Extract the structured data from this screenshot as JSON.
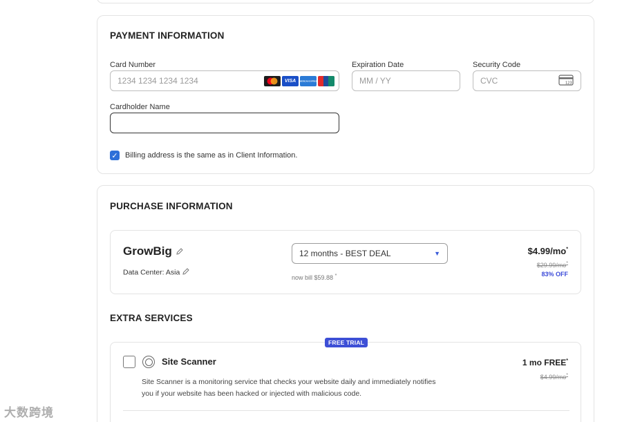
{
  "payment": {
    "title": "PAYMENT INFORMATION",
    "card_number": {
      "label": "Card Number",
      "placeholder": "1234 1234 1234 1234"
    },
    "expiration": {
      "label": "Expiration Date",
      "placeholder": "MM / YY"
    },
    "security": {
      "label": "Security Code",
      "placeholder": "CVC"
    },
    "cardholder": {
      "label": "Cardholder Name",
      "value": ""
    },
    "card_brands": [
      "mastercard-icon",
      "visa-icon",
      "amex-icon",
      "unionpay-icon"
    ],
    "brand_labels": {
      "visa": "VISA",
      "amex": "AMERICAN EXPRESS"
    },
    "billing_same": {
      "checked": true,
      "label": "Billing address is the same as in Client Information."
    }
  },
  "purchase": {
    "title": "PURCHASE INFORMATION",
    "plan": {
      "name": "GrowBig",
      "data_center": "Data Center: Asia",
      "period_selected": "12 months - BEST DEAL",
      "now_bill": "now bill $59.88",
      "price": "$4.99/mo",
      "old_price": "$29.99/mo",
      "discount": "83% OFF"
    },
    "extras_title": "EXTRA SERVICES",
    "site_scanner": {
      "badge": "FREE TRIAL",
      "checked": false,
      "name": "Site Scanner",
      "description": "Site Scanner is a monitoring service that checks your website daily and immediately notifies you if your website has been hacked or injected with malicious code.",
      "price": "1 mo FREE",
      "old_price": "$4.99/mo"
    }
  },
  "watermark": "大数跨境",
  "colors": {
    "accent": "#3d4fd6",
    "checkbox": "#2d6fd8",
    "border": "#e3e3e3"
  }
}
